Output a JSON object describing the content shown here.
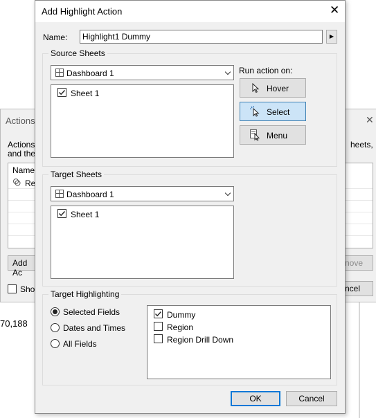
{
  "background_dialog": {
    "title": "Actions",
    "text_line1": "Actions l",
    "text_line2": "and the",
    "text_right": "heets,",
    "column_name": "Name",
    "row1": "Reg",
    "add_action_label": "Add Ac",
    "remove_label": "nove",
    "show_label": "Show",
    "cancel_label": "ncel",
    "bottom_value": "70,188"
  },
  "dialog": {
    "title": "Add Highlight Action",
    "name_label": "Name:",
    "name_value": "Highlight1 Dummy",
    "source": {
      "group_label": "Source Sheets",
      "dropdown_value": "Dashboard 1",
      "sheets": [
        {
          "label": "Sheet 1",
          "checked": true
        }
      ]
    },
    "run_action": {
      "label": "Run action on:",
      "options": [
        {
          "label": "Hover",
          "icon": "cursor-icon",
          "selected": false
        },
        {
          "label": "Select",
          "icon": "click-cursor-icon",
          "selected": true
        },
        {
          "label": "Menu",
          "icon": "menu-cursor-icon",
          "selected": false
        }
      ]
    },
    "target": {
      "group_label": "Target Sheets",
      "dropdown_value": "Dashboard 1",
      "sheets": [
        {
          "label": "Sheet 1",
          "checked": true
        }
      ]
    },
    "highlighting": {
      "group_label": "Target Highlighting",
      "options": [
        {
          "label": "Selected Fields",
          "selected": true
        },
        {
          "label": "Dates and Times",
          "selected": false
        },
        {
          "label": "All Fields",
          "selected": false
        }
      ],
      "fields": [
        {
          "label": "Dummy",
          "checked": true
        },
        {
          "label": "Region",
          "checked": false
        },
        {
          "label": "Region Drill Down",
          "checked": false
        }
      ]
    },
    "ok_label": "OK",
    "cancel_label": "Cancel"
  },
  "colors": {
    "dialog_bg": "#f0f0f0",
    "selected_button": "#cce4f7",
    "default_button_border": "#0078d7"
  }
}
